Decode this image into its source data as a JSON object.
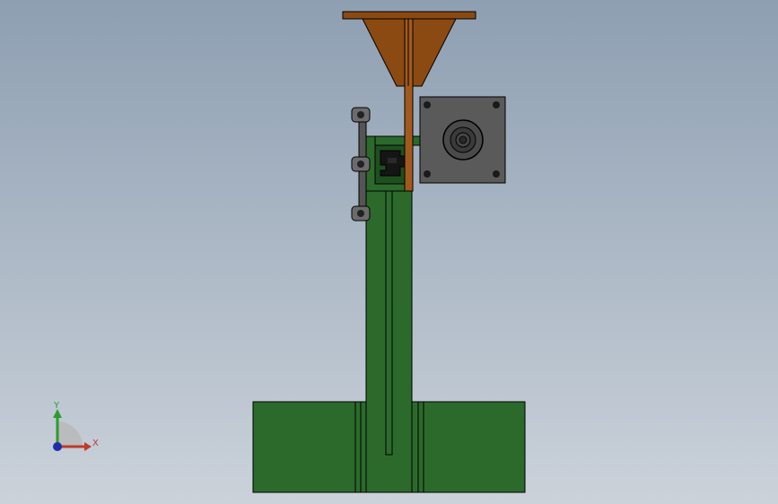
{
  "viewport": {
    "background_top": "#8e9fb2",
    "background_bottom": "#cbd2da"
  },
  "model": {
    "colors": {
      "steel_green": "#2c6a2c",
      "steel_green_dark": "#1f4f1f",
      "bracket_orange": "#8b4a12",
      "bracket_orange_light": "#a25a1c",
      "motor_gray": "#5a5a5a",
      "motor_dark": "#3a3a3a",
      "edge": "#000000"
    }
  },
  "triad": {
    "x_label": "X",
    "y_label": "Y",
    "x_color": "#c0392b",
    "y_color": "#2e9b2e",
    "z_color": "#1c2fa8"
  }
}
